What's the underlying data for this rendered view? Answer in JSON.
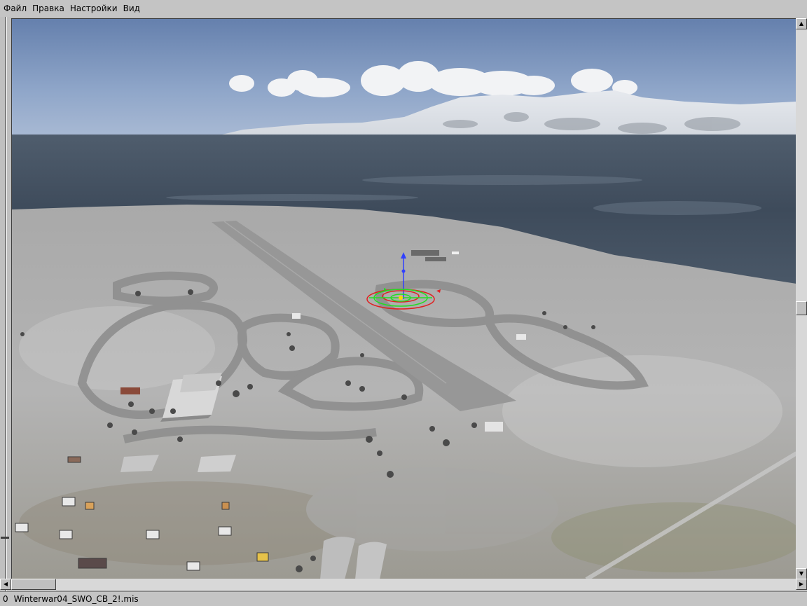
{
  "menu": {
    "items": [
      {
        "label": "Файл"
      },
      {
        "label": "Правка"
      },
      {
        "label": "Настройки"
      },
      {
        "label": "Вид"
      }
    ]
  },
  "scrollbars": {
    "up_arrow": "▲",
    "down_arrow": "▼",
    "left_arrow": "◀",
    "right_arrow": "▶"
  },
  "status": {
    "counter": "0",
    "mission": "Winterwar04_SWO_CB_2!.mis"
  },
  "colors": {
    "sky_top": "#6f89b3",
    "sea": "#3d4a5a",
    "snow": "#c9c9c9",
    "runway": "#8c8c8c",
    "marker_green": "#22dd22",
    "marker_red": "#e02020",
    "marker_blue": "#3040ff"
  }
}
